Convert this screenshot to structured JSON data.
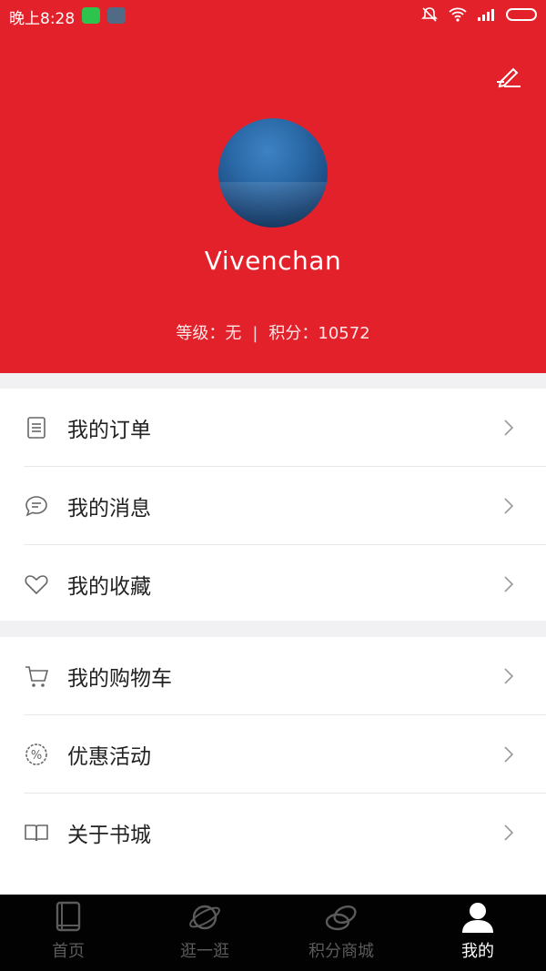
{
  "status_bar": {
    "time": "晚上8:28",
    "icons": [
      "wechat-icon",
      "gallery-icon",
      "mute-icon",
      "wifi-icon",
      "signal-icon",
      "battery-icon"
    ]
  },
  "profile": {
    "username": "Vivenchan",
    "level_label": "等级：无",
    "separator": "|",
    "points_label": "积分：10572"
  },
  "menu": {
    "group1": [
      {
        "label": "我的订单",
        "icon": "clipboard-icon"
      },
      {
        "label": "我的消息",
        "icon": "chat-bubble-icon"
      },
      {
        "label": "我的收藏",
        "icon": "heart-icon"
      }
    ],
    "group2": [
      {
        "label": "我的购物车",
        "icon": "cart-icon"
      },
      {
        "label": "优惠活动",
        "icon": "percent-badge-icon"
      },
      {
        "label": "关于书城",
        "icon": "open-book-icon"
      }
    ]
  },
  "tabs": [
    {
      "label": "首页",
      "icon": "book-icon",
      "active": false
    },
    {
      "label": "逛一逛",
      "icon": "planet-icon",
      "active": false
    },
    {
      "label": "积分商城",
      "icon": "coins-icon",
      "active": false
    },
    {
      "label": "我的",
      "icon": "user-icon",
      "active": true
    }
  ],
  "colors": {
    "header_red": "#e3212b",
    "tabbar_bg": "#020202",
    "tab_active": "#ffffff",
    "tab_inactive": "#5b5b5b"
  }
}
